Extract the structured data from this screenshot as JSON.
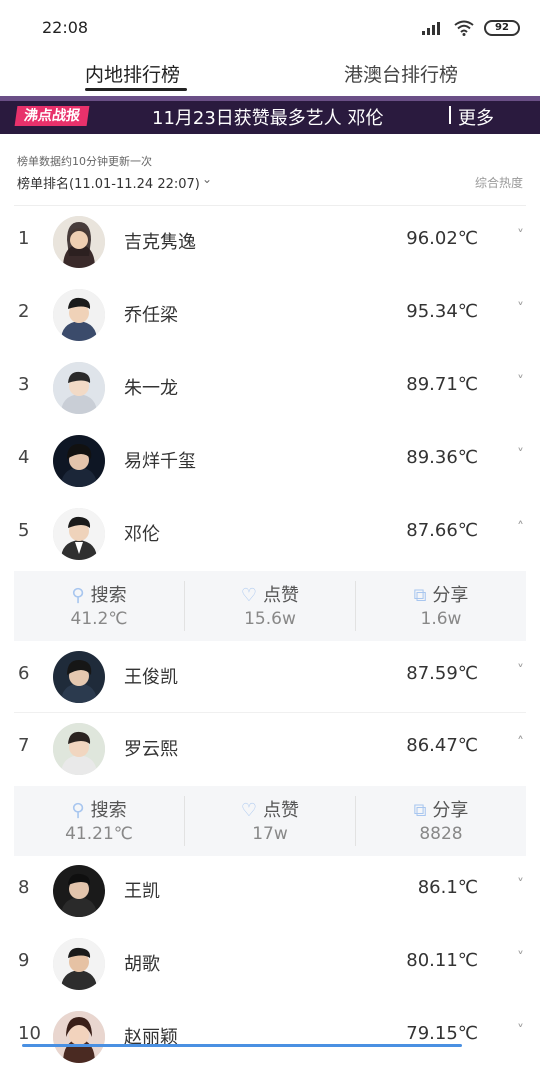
{
  "status": {
    "time": "22:08",
    "battery": "92"
  },
  "tabs": [
    {
      "label": "内地排行榜",
      "active": true
    },
    {
      "label": "港澳台排行榜",
      "active": false
    }
  ],
  "banner": {
    "logo": "沸点战报",
    "text": "11月23日获赞最多艺人 邓伦",
    "more": "更多"
  },
  "meta": {
    "note": "榜单数据约10分钟更新一次",
    "rank_period": "榜单排名(11.01-11.24 22:07)",
    "heat_label": "综合热度"
  },
  "rows": [
    {
      "rank": "1",
      "name": "吉克隽逸",
      "score": "96.02℃",
      "chevron": "˅"
    },
    {
      "rank": "2",
      "name": "乔任梁",
      "score": "95.34℃",
      "chevron": "˅"
    },
    {
      "rank": "3",
      "name": "朱一龙",
      "score": "89.71℃",
      "chevron": "˅"
    },
    {
      "rank": "4",
      "name": "易烊千玺",
      "score": "89.36℃",
      "chevron": "˅"
    },
    {
      "rank": "5",
      "name": "邓伦",
      "score": "87.66℃",
      "chevron": "˄"
    },
    {
      "rank": "6",
      "name": "王俊凯",
      "score": "87.59℃",
      "chevron": "˅"
    },
    {
      "rank": "7",
      "name": "罗云熙",
      "score": "86.47℃",
      "chevron": "˄"
    },
    {
      "rank": "8",
      "name": "王凯",
      "score": "86.1℃",
      "chevron": "˅"
    },
    {
      "rank": "9",
      "name": "胡歌",
      "score": "80.11℃",
      "chevron": "˅"
    },
    {
      "rank": "10",
      "name": "赵丽颖",
      "score": "79.15℃",
      "chevron": "˅"
    }
  ],
  "stats_5": {
    "search_label": "搜索",
    "search_val": "41.2℃",
    "like_label": "点赞",
    "like_val": "15.6w",
    "share_label": "分享",
    "share_val": "1.6w"
  },
  "stats_7": {
    "search_label": "搜索",
    "search_val": "41.21℃",
    "like_label": "点赞",
    "like_val": "17w",
    "share_label": "分享",
    "share_val": "8828"
  },
  "colors": {
    "accent": "#a8c6ef",
    "banner_bg": "#2a1a3e",
    "logo": "#e8316b"
  }
}
